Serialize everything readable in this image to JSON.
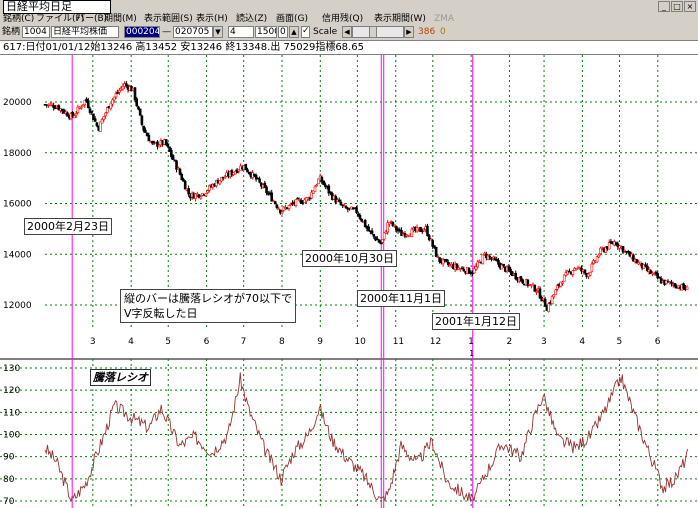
{
  "window": {
    "title": "日経平均日足",
    "buttons": [
      "_",
      "□",
      "×"
    ]
  },
  "menubar": [
    "銘柄(C)",
    "ファイル(F)",
    "バー(B)",
    "期間(M)",
    "表示範囲(S)",
    "表示(H)",
    "読込(Z)",
    "画面(G)",
    "信用残(Q)",
    "表示期間(W)",
    "ZMA"
  ],
  "toolbar": {
    "code_label": "銘柄",
    "code": "1004",
    "name": "日経平均株価",
    "from": "000204",
    "to": "020705",
    "val1": "4",
    "val2": "1500",
    "val3": "0",
    "scale_label": "Scale",
    "scale_checked": true,
    "count1": "386",
    "count2": "0"
  },
  "status": "617:日付01/01/12始13246 高13452 安13246 終13348.出 75029指標68.65",
  "annotations": {
    "feb": "2000年2月23日",
    "oct": "2000年10月30日",
    "nov": "2000年11月1日",
    "jan": "2001年1月12日",
    "note_line1": "縦のバーは騰落レシオが70以下で",
    "note_line2": "V字反転した日"
  },
  "indicator_label": "騰落レシオ",
  "colors": {
    "background": "#ffffff",
    "grid": "#008000",
    "up": "#ff0000",
    "down": "#000000",
    "marker": "#ff00ff",
    "ratio": "#993333"
  },
  "chart_data": [
    {
      "type": "candlestick",
      "title": "日経平均日足",
      "y_ticks": [
        12000,
        14000,
        16000,
        18000,
        20000
      ],
      "ylim": [
        11300,
        21700
      ],
      "x_ticks": [
        "3",
        "4",
        "5",
        "6",
        "7",
        "8",
        "9",
        "10",
        "11",
        "12",
        "1",
        "2",
        "3",
        "4",
        "5",
        "6"
      ],
      "year_marker": "1",
      "grid": true,
      "close_path": [
        [
          "2000-02-01",
          19900
        ],
        [
          "2000-02-10",
          19850
        ],
        [
          "2000-02-23",
          19400
        ],
        [
          "2000-03-05",
          20100
        ],
        [
          "2000-03-15",
          18950
        ],
        [
          "2000-03-25",
          20000
        ],
        [
          "2000-04-05",
          20700
        ],
        [
          "2000-04-12",
          20500
        ],
        [
          "2000-04-20",
          19000
        ],
        [
          "2000-04-28",
          18300
        ],
        [
          "2000-05-08",
          18400
        ],
        [
          "2000-05-18",
          17400
        ],
        [
          "2000-05-28",
          16300
        ],
        [
          "2000-06-08",
          16400
        ],
        [
          "2000-06-20",
          16900
        ],
        [
          "2000-07-01",
          17200
        ],
        [
          "2000-07-10",
          17500
        ],
        [
          "2000-07-20",
          17000
        ],
        [
          "2000-08-01",
          16300
        ],
        [
          "2000-08-10",
          15700
        ],
        [
          "2000-08-20",
          16000
        ],
        [
          "2000-09-01",
          16200
        ],
        [
          "2000-09-10",
          17000
        ],
        [
          "2000-09-20",
          16300
        ],
        [
          "2000-09-30",
          15800
        ],
        [
          "2000-10-10",
          15700
        ],
        [
          "2000-10-20",
          14900
        ],
        [
          "2000-10-30",
          14400
        ],
        [
          "2000-11-05",
          15300
        ],
        [
          "2000-11-15",
          14800
        ],
        [
          "2000-11-25",
          14900
        ],
        [
          "2000-12-05",
          15000
        ],
        [
          "2000-12-15",
          13800
        ],
        [
          "2000-12-22",
          13600
        ],
        [
          "2001-01-12",
          13300
        ],
        [
          "2001-01-22",
          14000
        ],
        [
          "2001-02-05",
          13500
        ],
        [
          "2001-02-20",
          13000
        ],
        [
          "2001-03-05",
          12600
        ],
        [
          "2001-03-13",
          11900
        ],
        [
          "2001-03-25",
          13000
        ],
        [
          "2001-04-05",
          13500
        ],
        [
          "2001-04-15",
          13200
        ],
        [
          "2001-04-25",
          14100
        ],
        [
          "2001-05-07",
          14500
        ],
        [
          "2001-05-20",
          13900
        ],
        [
          "2001-06-01",
          13400
        ],
        [
          "2001-06-15",
          12900
        ],
        [
          "2001-06-25",
          12800
        ],
        [
          "2001-07-05",
          12600
        ]
      ]
    },
    {
      "type": "line",
      "title": "騰落レシオ",
      "y_ticks": [
        70,
        80,
        90,
        100,
        110,
        120,
        130
      ],
      "ylim": [
        70,
        130
      ],
      "grid": true,
      "points": [
        [
          "2000-02-01",
          94
        ],
        [
          "2000-02-10",
          88
        ],
        [
          "2000-02-23",
          70
        ],
        [
          "2000-03-05",
          78
        ],
        [
          "2000-03-20",
          100
        ],
        [
          "2000-03-28",
          113
        ],
        [
          "2000-04-10",
          108
        ],
        [
          "2000-04-25",
          103
        ],
        [
          "2000-05-05",
          112
        ],
        [
          "2000-05-20",
          95
        ],
        [
          "2000-06-01",
          99
        ],
        [
          "2000-06-15",
          92
        ],
        [
          "2000-06-28",
          100
        ],
        [
          "2000-07-08",
          125
        ],
        [
          "2000-07-15",
          111
        ],
        [
          "2000-07-28",
          93
        ],
        [
          "2000-08-10",
          80
        ],
        [
          "2000-08-20",
          92
        ],
        [
          "2000-09-01",
          100
        ],
        [
          "2000-09-10",
          112
        ],
        [
          "2000-09-20",
          98
        ],
        [
          "2000-10-01",
          90
        ],
        [
          "2000-10-15",
          82
        ],
        [
          "2000-10-30",
          70
        ],
        [
          "2000-11-05",
          74
        ],
        [
          "2000-11-15",
          95
        ],
        [
          "2000-11-28",
          87
        ],
        [
          "2000-12-10",
          97
        ],
        [
          "2000-12-22",
          79
        ],
        [
          "2001-01-12",
          70
        ],
        [
          "2001-01-22",
          82
        ],
        [
          "2001-02-05",
          96
        ],
        [
          "2001-02-20",
          90
        ],
        [
          "2001-03-01",
          105
        ],
        [
          "2001-03-10",
          118
        ],
        [
          "2001-03-22",
          98
        ],
        [
          "2001-04-05",
          94
        ],
        [
          "2001-04-18",
          100
        ],
        [
          "2001-05-01",
          113
        ],
        [
          "2001-05-12",
          126
        ],
        [
          "2001-05-22",
          110
        ],
        [
          "2001-06-05",
          90
        ],
        [
          "2001-06-15",
          76
        ],
        [
          "2001-06-25",
          80
        ],
        [
          "2001-07-05",
          91
        ]
      ]
    }
  ],
  "markers": [
    "2000-02-23",
    "2000-10-30",
    "2000-11-01",
    "2001-01-12"
  ]
}
